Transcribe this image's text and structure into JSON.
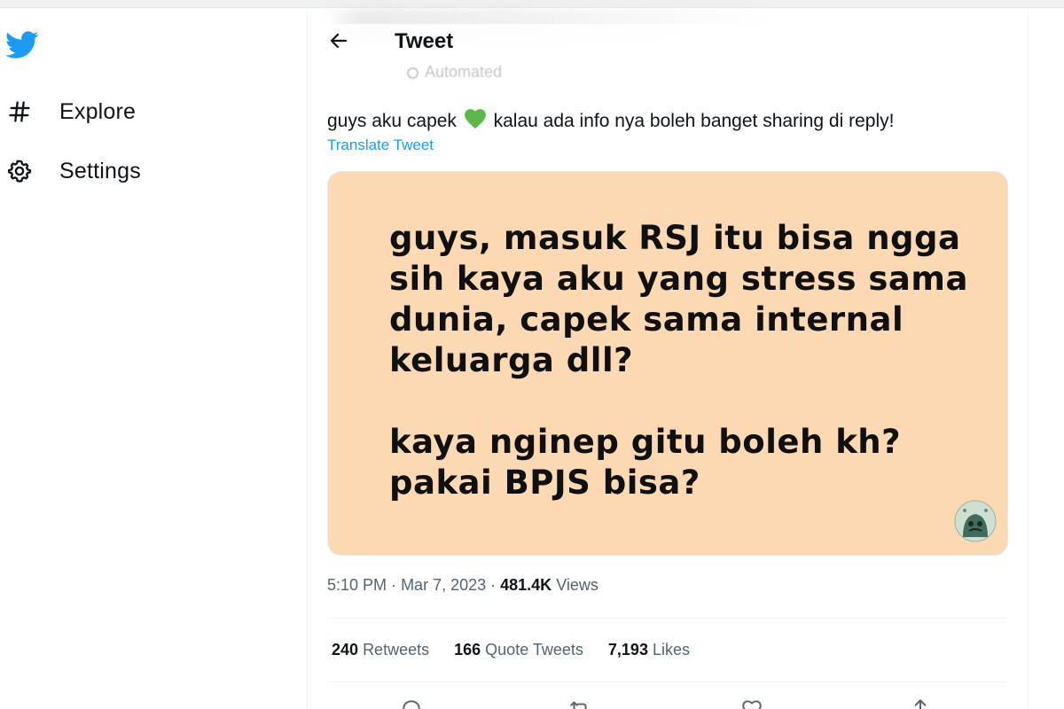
{
  "sidebar": {
    "logo_icon": "twitter-bird-icon",
    "items": [
      {
        "label": "Explore",
        "icon": "hashtag-icon"
      },
      {
        "label": "Settings",
        "icon": "gear-icon"
      }
    ]
  },
  "header": {
    "back_icon": "arrow-left-icon",
    "title": "Tweet"
  },
  "author": {
    "automated_label": "Automated"
  },
  "tweet": {
    "text_before_emoji": "guys aku capek",
    "emoji": "green-heart-icon",
    "text_after_emoji": "kalau ada info nya boleh banget sharing di reply!",
    "translate_label": "Translate Tweet",
    "image_text": {
      "paragraph1": [
        "guys, masuk RSJ itu bisa ngga",
        "sih kaya aku yang stress sama",
        "dunia, capek sama internal",
        "keluarga dll?"
      ],
      "paragraph2": [
        "kaya nginep gitu boleh kh?",
        "pakai BPJS bisa?"
      ]
    },
    "time": "5:10 PM",
    "date": "Mar 7, 2023",
    "views_count": "481.4K",
    "views_label": "Views"
  },
  "stats": {
    "retweets_count": "240",
    "retweets_label": "Retweets",
    "quote_count": "166",
    "quote_label": "Quote Tweets",
    "likes_count": "7,193",
    "likes_label": "Likes"
  },
  "colors": {
    "brand": "#1d9bf0",
    "text": "#0f1419",
    "secondary": "#536471",
    "media_bg": "#fdd9b3",
    "heart": "#5db84a"
  }
}
